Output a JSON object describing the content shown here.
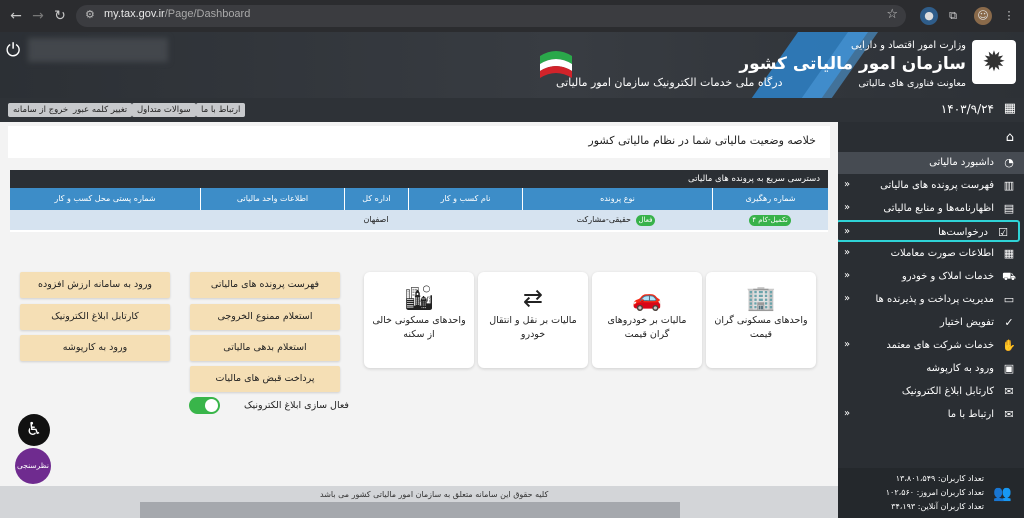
{
  "browser": {
    "url_host": "my.tax.gov.ir",
    "url_path": "/Page/Dashboard"
  },
  "header": {
    "ministry": "وزارت امور اقتصاد و دارایی",
    "org_name": "سازمان امور مالیاتی کشور",
    "deputy": "معاونت فناوری های مالیاتی",
    "portal_title": "درگاه ملی خدمات الکترونیک سازمان امور مالیاتی"
  },
  "toolbar": {
    "contact": "ارتباط با ما",
    "faq": "سوالات متداول",
    "change_password": "تغییر کلمه عبور",
    "logout": "خروج از سامانه",
    "date": "۱۴۰۳/۹/۲۴"
  },
  "sidebar": {
    "items": [
      {
        "label": "داشبورد مالیاتی",
        "icon": "gauge-icon",
        "chevron": false,
        "active": true
      },
      {
        "label": "فهرست پرونده های مالیاتی",
        "icon": "building-icon",
        "chevron": true
      },
      {
        "label": "اظهارنامه‌ها و منابع مالیاتی",
        "icon": "document-icon",
        "chevron": true
      },
      {
        "label": "درخواست‌ها",
        "icon": "checklist-icon",
        "chevron": true,
        "highlight": true
      },
      {
        "label": "اطلاعات صورت معاملات",
        "icon": "chart-icon",
        "chevron": true
      },
      {
        "label": "خدمات املاک و خودرو",
        "icon": "car-icon",
        "chevron": true
      },
      {
        "label": "مدیریت پرداخت و پذیرنده ها",
        "icon": "card-icon",
        "chevron": true
      },
      {
        "label": "تفویض اختیار",
        "icon": "check-doc-icon",
        "chevron": false
      },
      {
        "label": "خدمات شرکت های معتمد",
        "icon": "handshake-icon",
        "chevron": true
      },
      {
        "label": "ورود به کارپوشه",
        "icon": "folder-icon",
        "chevron": false
      },
      {
        "label": "کارتابل ابلاغ الکترونیک",
        "icon": "inbox-icon",
        "chevron": false
      },
      {
        "label": "ارتباط با ما",
        "icon": "mail-icon",
        "chevron": true
      }
    ],
    "stats": [
      "تعداد کاربران: ۱۳،۸۰۱،۵۴۹",
      "تعداد کاربران امروز: ۱۰۲،۵۶۰",
      "تعداد کاربران آنلاین: ۳۴،۱۹۳"
    ]
  },
  "main": {
    "title": "خلاصه وضعیت مالیاتی شما در نظام مالیاتی کشور",
    "quick_access": {
      "heading": "دسترسی سریع به پرونده های مالیاتی",
      "columns": [
        "شماره رهگیری",
        "نوع پرونده",
        "نام کسب و کار",
        "اداره کل",
        "اطلاعات واحد مالیاتی",
        "شماره پستی محل کسب و کار"
      ],
      "row": {
        "tracking_badge": "تکمیل-کام ۴",
        "file_type": "حقیقی-مشارکت",
        "file_type_badge": "فعال",
        "business_name": "",
        "office": "اصفهان",
        "unit_info": "",
        "postal_code": ""
      }
    },
    "cards": [
      {
        "label": "واحدهای مسکونی گران قیمت",
        "icon": "tall-building-icon"
      },
      {
        "label": "مالیات بر خودروهای گران قیمت",
        "icon": "car-icon"
      },
      {
        "label": "مالیات بر نقل و انتقال خودرو",
        "icon": "car-transfer-icon"
      },
      {
        "label": "واحدهای مسکونی خالی از سکنه",
        "icon": "empty-buildings-icon"
      }
    ],
    "actions_col1": [
      "فهرست پرونده های مالیاتی",
      "استعلام ممنوع الخروجی",
      "استعلام بدهی مالیاتی",
      "پرداخت قبض های مالیات"
    ],
    "actions_col2": [
      "ورود به سامانه ارزش افزوده",
      "کارتابل ابلاغ الکترونیک",
      "ورود به کارپوشه"
    ],
    "toggle_label": "فعال سازی ابلاغ الکترونیک",
    "toggle_on": true
  },
  "footer": {
    "copyright": "کلیه حقوق این سامانه متعلق به سازمان امور مالیاتی کشور می باشد"
  },
  "widgets": {
    "survey": "نظرسنجی"
  },
  "colors": {
    "header_dark": "#2e3237",
    "table_head": "#3d8dc8",
    "action_button": "#f5dfb5",
    "highlight": "#2fd3d6",
    "toggle": "#39b54a"
  }
}
